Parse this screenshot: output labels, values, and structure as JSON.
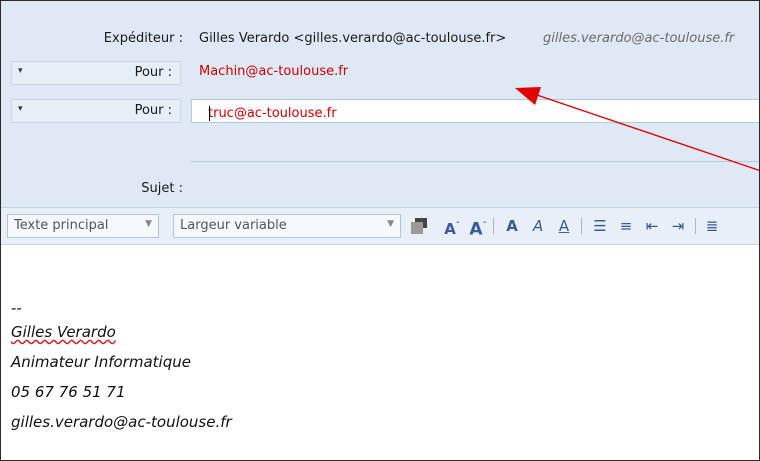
{
  "header": {
    "from_label": "Expéditeur :",
    "from_value": "Gilles Verardo <gilles.verardo@ac-toulouse.fr>",
    "from_alt": "gilles.verardo@ac-toulouse.fr",
    "recipients": [
      {
        "type_label": "Pour :",
        "value": "Machin@ac-toulouse.fr"
      },
      {
        "type_label": "Pour :",
        "value": "truc@ac-toulouse.fr"
      }
    ],
    "subject_label": "Sujet :",
    "subject_value": ""
  },
  "toolbar": {
    "paragraph_format": "Texte principal",
    "font_family": "Largeur variable",
    "icons": [
      "text-color-icon",
      "decrease-font-icon",
      "increase-font-icon",
      "bold-icon",
      "italic-icon",
      "underline-icon",
      "bullet-list-icon",
      "numbered-list-icon",
      "outdent-icon",
      "indent-icon",
      "align-icon"
    ]
  },
  "body": {
    "signature_separator": "--",
    "signature_lines": [
      "Gilles Verardo",
      "Animateur Informatique",
      "05 67 76 51 71",
      "gilles.verardo@ac-toulouse.fr"
    ]
  },
  "colors": {
    "header_bg": "#dfe9f5",
    "recipient_text": "#cc0000",
    "annotation_arrow": "#e00000"
  }
}
